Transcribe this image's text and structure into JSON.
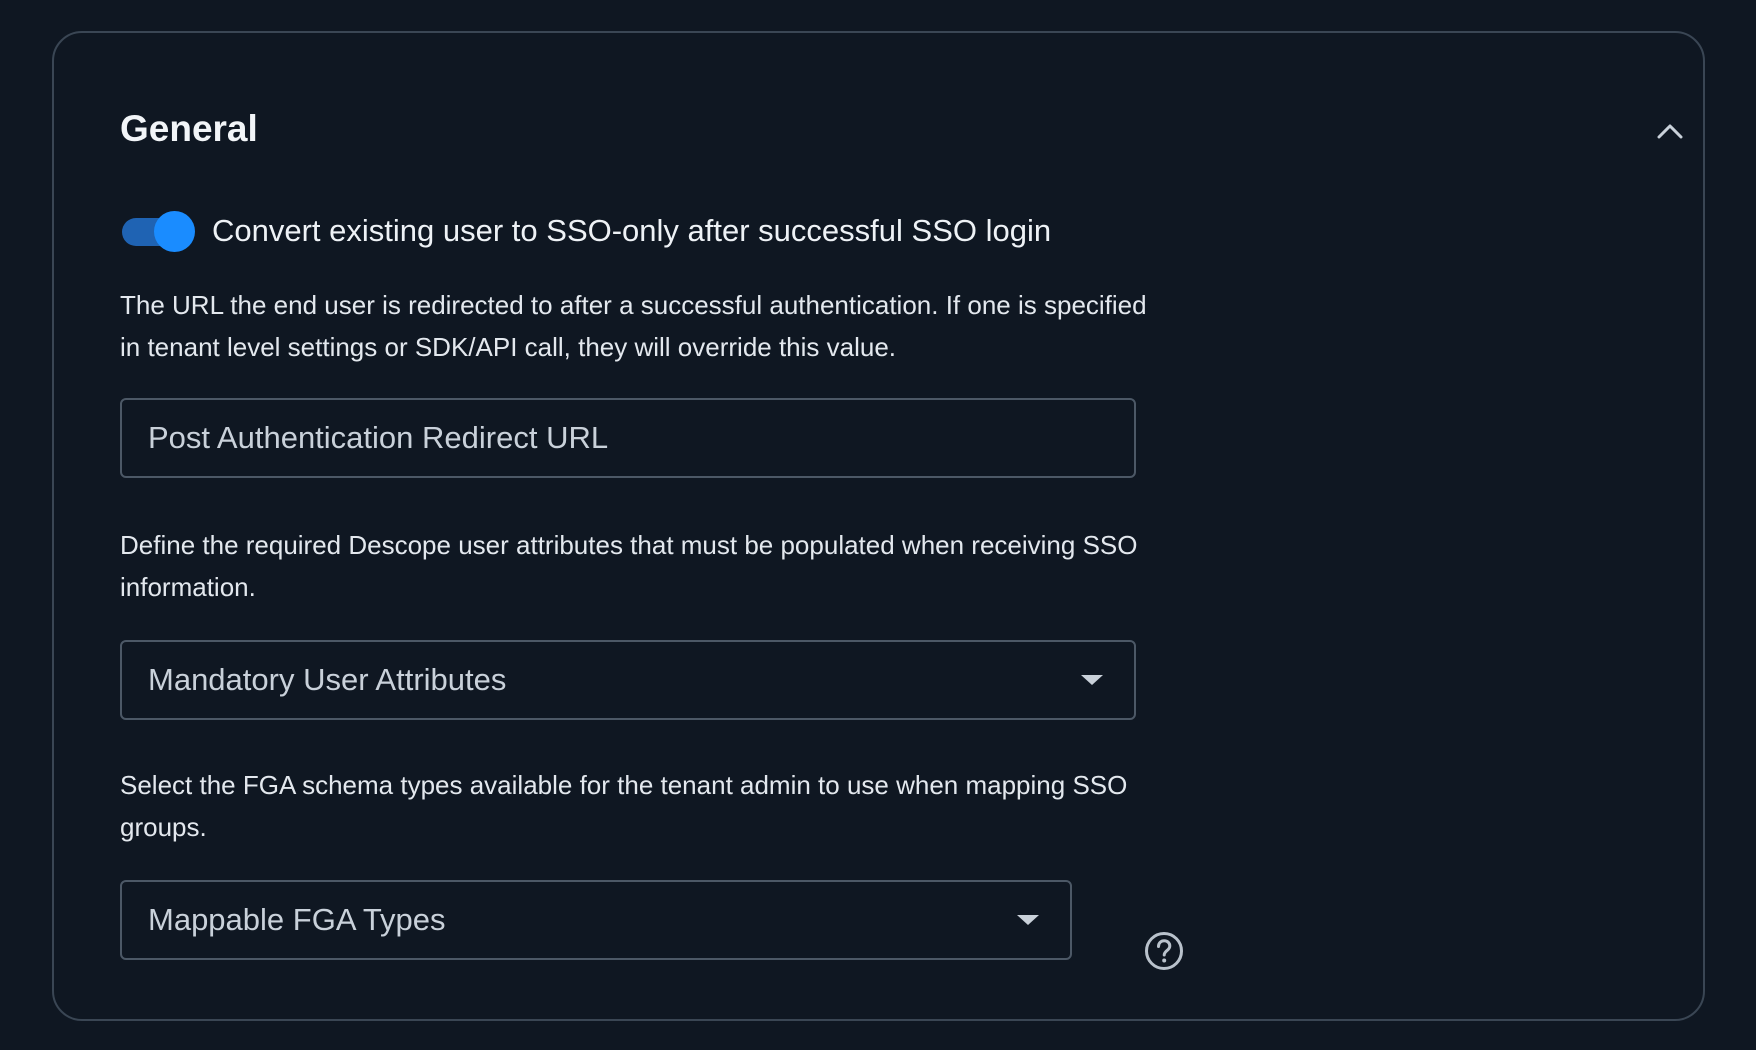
{
  "section": {
    "title": "General",
    "collapse_icon": "chevron-up-icon"
  },
  "sso_only_toggle": {
    "label": "Convert existing user to SSO-only after successful SSO login",
    "checked": true,
    "color": "#1a8cff"
  },
  "redirect": {
    "description": "The URL the end user is redirected to after a successful authentication. If one is specified in tenant level settings or SDK/API call, they will override this value.",
    "placeholder": "Post Authentication Redirect URL"
  },
  "mandatory_attributes": {
    "description": "Define the required Descope user attributes that must be populated when receiving SSO information.",
    "placeholder": "Mandatory User Attributes"
  },
  "fga_types": {
    "description": "Select the FGA schema types available for the tenant admin to use when mapping SSO groups.",
    "placeholder": "Mappable FGA Types",
    "help_icon": "help-circle-icon"
  },
  "colors": {
    "background": "#0f1722",
    "border": "#3a4654",
    "accent": "#1a8cff"
  }
}
